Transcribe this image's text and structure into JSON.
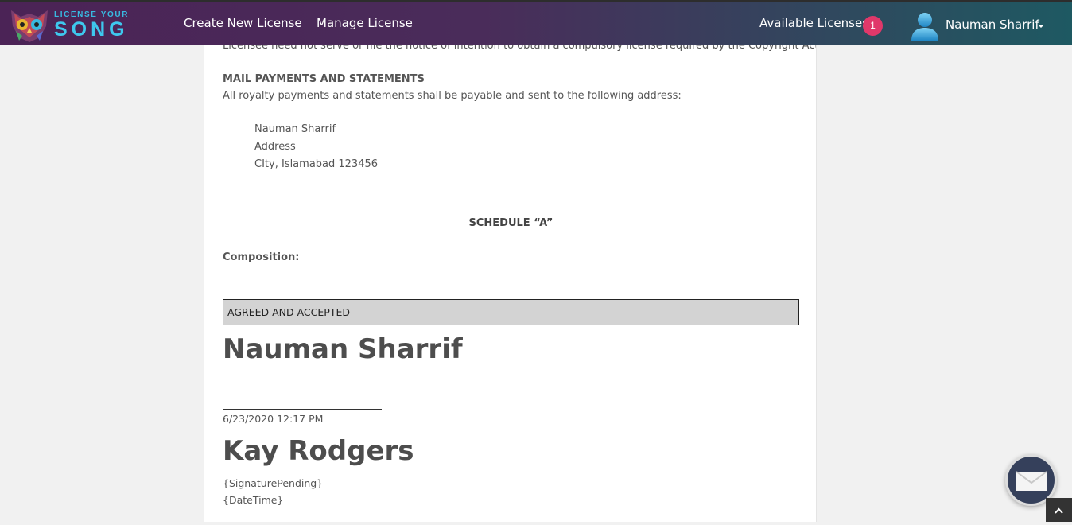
{
  "brand": {
    "logo_small": "LICENSE YOUR",
    "logo_big": "SONG"
  },
  "nav": {
    "create_link": "Create New License",
    "manage_link": "Manage License",
    "available_label": "Available Licenses",
    "available_count": "1",
    "user_name": "Nauman Sharrif"
  },
  "doc": {
    "top_clipped_text": "Licensee need not serve or file the notice of intention to obtain a compulsory license required by the Copyright Act.",
    "mail_heading": "MAIL PAYMENTS AND STATEMENTS",
    "mail_body": "All royalty payments and statements shall be payable and sent to the following address:",
    "address": [
      "Nauman Sharrif",
      "Address",
      "CIty, Islamabad 123456"
    ],
    "schedule_heading": "SCHEDULE “A”",
    "composition_label": "Composition:",
    "agreed_label": "AGREED AND ACCEPTED",
    "signer1": {
      "name": "Nauman Sharrif",
      "date": "6/23/2020 12:17 PM"
    },
    "signer2": {
      "name": "Kay Rodgers",
      "status": "{SignaturePending}",
      "date": "{DateTime}"
    }
  },
  "colors": {
    "nav_gradient_start": "#4b2356",
    "nav_gradient_end": "#1e5962",
    "badge": "#e0386a",
    "logo_accent": "#3ec8ee"
  },
  "icons": {
    "user": "user-avatar-icon",
    "mail": "mail-icon",
    "scroll_top": "chevron-up-icon",
    "dropdown": "caret-down-icon"
  }
}
